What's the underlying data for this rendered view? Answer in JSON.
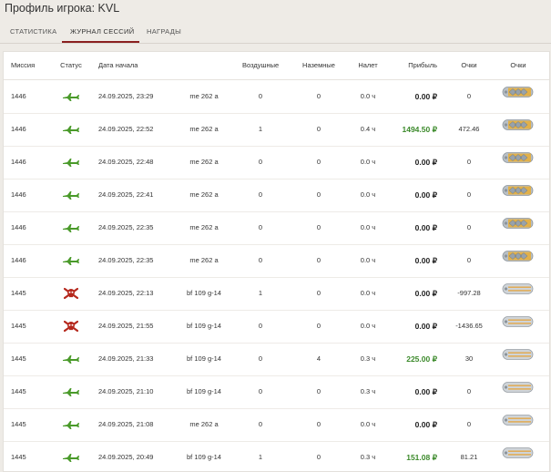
{
  "page": {
    "title": "Профиль игрока: KVL"
  },
  "tabs": [
    {
      "label": "СТАТИСТИКА",
      "active": false
    },
    {
      "label": "ЖУРНАЛ СЕССИЙ",
      "active": true
    },
    {
      "label": "НАГРАДЫ",
      "active": false
    }
  ],
  "table": {
    "headers": {
      "mission": "Миссия",
      "status": "Статус",
      "date": "Дата начала",
      "air": "Воздушные",
      "ground": "Наземные",
      "flight": "Налет",
      "profit": "Прибыль",
      "points": "Очки",
      "rank": "Очки"
    },
    "rows": [
      {
        "mission": "1446",
        "status": "landed",
        "date": "24.09.2025, 23:29",
        "aircraft": "me 262 a",
        "air": "0",
        "ground": "0",
        "flight": "0.0 ч",
        "profit": "0.00 ₽",
        "positive": false,
        "points": "0",
        "rank": "yellow"
      },
      {
        "mission": "1446",
        "status": "landed",
        "date": "24.09.2025, 22:52",
        "aircraft": "me 262 a",
        "air": "1",
        "ground": "0",
        "flight": "0.4 ч",
        "profit": "1494.50 ₽",
        "positive": true,
        "points": "472.46",
        "rank": "yellow"
      },
      {
        "mission": "1446",
        "status": "landed",
        "date": "24.09.2025, 22:48",
        "aircraft": "me 262 a",
        "air": "0",
        "ground": "0",
        "flight": "0.0 ч",
        "profit": "0.00 ₽",
        "positive": false,
        "points": "0",
        "rank": "yellow"
      },
      {
        "mission": "1446",
        "status": "landed",
        "date": "24.09.2025, 22:41",
        "aircraft": "me 262 a",
        "air": "0",
        "ground": "0",
        "flight": "0.0 ч",
        "profit": "0.00 ₽",
        "positive": false,
        "points": "0",
        "rank": "yellow"
      },
      {
        "mission": "1446",
        "status": "landed",
        "date": "24.09.2025, 22:35",
        "aircraft": "me 262 a",
        "air": "0",
        "ground": "0",
        "flight": "0.0 ч",
        "profit": "0.00 ₽",
        "positive": false,
        "points": "0",
        "rank": "yellow"
      },
      {
        "mission": "1446",
        "status": "landed",
        "date": "24.09.2025, 22:35",
        "aircraft": "me 262 a",
        "air": "0",
        "ground": "0",
        "flight": "0.0 ч",
        "profit": "0.00 ₽",
        "positive": false,
        "points": "0",
        "rank": "yellow"
      },
      {
        "mission": "1445",
        "status": "killed",
        "date": "24.09.2025, 22:13",
        "aircraft": "bf 109 g-14",
        "air": "1",
        "ground": "0",
        "flight": "0.0 ч",
        "profit": "0.00 ₽",
        "positive": false,
        "points": "-997.28",
        "rank": "silver"
      },
      {
        "mission": "1445",
        "status": "killed",
        "date": "24.09.2025, 21:55",
        "aircraft": "bf 109 g-14",
        "air": "0",
        "ground": "0",
        "flight": "0.0 ч",
        "profit": "0.00 ₽",
        "positive": false,
        "points": "-1436.65",
        "rank": "silver"
      },
      {
        "mission": "1445",
        "status": "landed",
        "date": "24.09.2025, 21:33",
        "aircraft": "bf 109 g-14",
        "air": "0",
        "ground": "4",
        "flight": "0.3 ч",
        "profit": "225.00 ₽",
        "positive": true,
        "points": "30",
        "rank": "silver"
      },
      {
        "mission": "1445",
        "status": "landed",
        "date": "24.09.2025, 21:10",
        "aircraft": "bf 109 g-14",
        "air": "0",
        "ground": "0",
        "flight": "0.3 ч",
        "profit": "0.00 ₽",
        "positive": false,
        "points": "0",
        "rank": "silver"
      },
      {
        "mission": "1445",
        "status": "landed",
        "date": "24.09.2025, 21:08",
        "aircraft": "me 262 a",
        "air": "0",
        "ground": "0",
        "flight": "0.0 ч",
        "profit": "0.00 ₽",
        "positive": false,
        "points": "0",
        "rank": "silver"
      },
      {
        "mission": "1445",
        "status": "landed",
        "date": "24.09.2025, 20:49",
        "aircraft": "bf 109 g-14",
        "air": "1",
        "ground": "0",
        "flight": "0.3 ч",
        "profit": "151.08 ₽",
        "positive": true,
        "points": "81.21",
        "rank": "silver"
      }
    ]
  },
  "colors": {
    "accent": "#8a1f1f",
    "profit_positive": "#3c8a2b",
    "landed_icon": "#4a9a2a",
    "killed_icon": "#b5281d"
  }
}
